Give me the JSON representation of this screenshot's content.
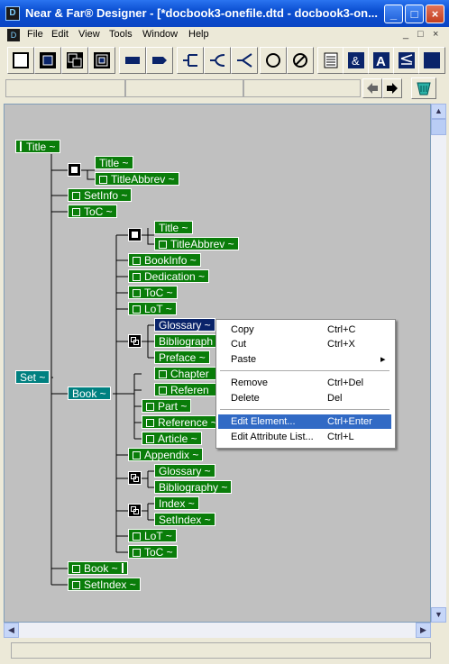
{
  "window": {
    "title": "Near & Far® Designer - [*docbook3-onefile.dtd - docbook3-on...",
    "app_icon": "D",
    "controls": [
      "minimize-icon",
      "maximize-icon",
      "close-icon"
    ]
  },
  "menu": {
    "items": [
      "File",
      "Edit",
      "View",
      "Tools",
      "Window",
      "Help"
    ],
    "mdi_controls": [
      "_",
      "□",
      "×"
    ]
  },
  "toolbar": {
    "buttons": [
      "element-icon",
      "sequence-icon",
      "choice-icon",
      "all-icon",
      "pcdata-icon",
      "reference-icon",
      "connector-seq-icon",
      "connector-choice-icon",
      "connector-any-icon",
      "optional-icon",
      "empty-icon",
      "attributes-icon",
      "entity-icon",
      "text-icon",
      "comment-icon",
      "doc-icon"
    ],
    "nav": [
      "back-arrow-icon",
      "forward-arrow-icon",
      "trash-icon"
    ]
  },
  "tree": {
    "nodes": {
      "title_top": "Title ~",
      "title2": "Title ~",
      "titleabbrev2": "TitleAbbrev ~",
      "setinfo": "SetInfo ~",
      "toc1": "ToC ~",
      "title3": "Title ~",
      "titleabbrev3": "TitleAbbrev ~",
      "bookinfo": "BookInfo ~",
      "dedication": "Dedication ~",
      "toc2": "ToC ~",
      "lot1": "LoT ~",
      "glossary1": "Glossary ~",
      "bibliography1": "Bibliograph",
      "preface": "Preface ~",
      "chapter": "Chapter",
      "reference_a": "Referen",
      "part": "Part ~",
      "reference": "Reference ~",
      "article": "Article ~",
      "appendix": "Appendix ~",
      "glossary2": "Glossary ~",
      "bibliography2": "Bibliography ~",
      "index": "Index ~",
      "setindex2": "SetIndex ~",
      "lot2": "LoT ~",
      "toc3": "ToC ~",
      "book2": "Book ~",
      "setindex": "SetIndex ~",
      "set": "Set ~",
      "book": "Book ~"
    }
  },
  "context_menu": {
    "items": [
      {
        "label": "Copy",
        "shortcut": "Ctrl+C"
      },
      {
        "label": "Cut",
        "shortcut": "Ctrl+X"
      },
      {
        "label": "Paste",
        "shortcut": "▸"
      },
      {
        "label": "Remove",
        "shortcut": "Ctrl+Del"
      },
      {
        "label": "Delete",
        "shortcut": "Del"
      },
      {
        "label": "Edit Element...",
        "shortcut": "Ctrl+Enter"
      },
      {
        "label": "Edit Attribute List...",
        "shortcut": "Ctrl+L"
      }
    ],
    "highlighted": "Edit Element..."
  },
  "colors": {
    "element_green": "#0a7d0a",
    "teal": "#008080",
    "selected": "#0a246a",
    "canvas": "#c0c0c0"
  }
}
